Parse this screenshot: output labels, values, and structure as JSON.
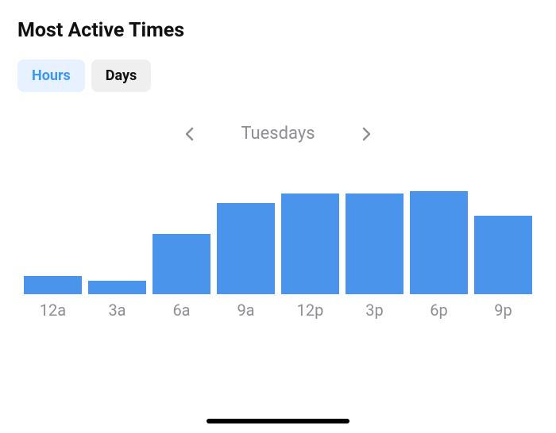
{
  "title": "Most Active Times",
  "tabs": {
    "hours_label": "Hours",
    "days_label": "Days",
    "active": "hours"
  },
  "day_nav": {
    "label": "Tuesdays"
  },
  "chart_data": {
    "type": "bar",
    "categories": [
      "12a",
      "3a",
      "6a",
      "9a",
      "12p",
      "3p",
      "6p",
      "9p"
    ],
    "values": [
      18,
      13,
      60,
      90,
      100,
      100,
      102,
      78
    ],
    "title": "Most Active Times",
    "xlabel": "",
    "ylabel": "",
    "ylim": [
      0,
      110
    ]
  },
  "colors": {
    "bar_fill": "#4a94ec",
    "tab_active_bg": "#e7f1ff",
    "tab_active_fg": "#3b97f5",
    "tab_inactive_bg": "#efefef",
    "muted_text": "#8e8e93"
  }
}
